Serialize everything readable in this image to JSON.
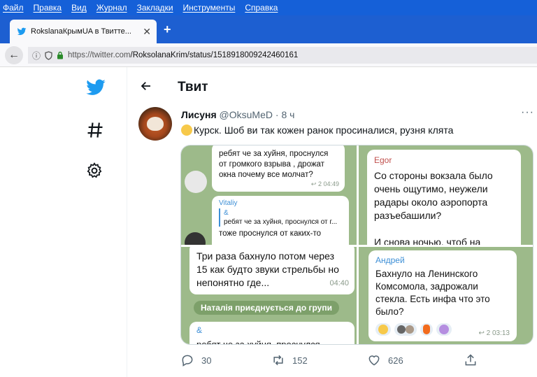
{
  "browser": {
    "menu": [
      "Файл",
      "Правка",
      "Вид",
      "Журнал",
      "Закладки",
      "Инструменты",
      "Справка"
    ],
    "tab_title": "RokslanaКрымUA в Твитте...",
    "url_prefix": "https://twitter.com",
    "url_path": "/RoksolanaKrim/status/1518918009242460161"
  },
  "page": {
    "title": "Твит"
  },
  "tweet": {
    "author_name": "Лисуня",
    "author_handle": "@OksuMeD",
    "separator": "·",
    "time": "8 ч",
    "text": "Курск. Шоб ви так кожен ранок просиналися, рузня клята",
    "replies": "30",
    "retweets": "152",
    "likes": "626"
  },
  "media": {
    "cell1": {
      "msg1": "ребят че за хуйня, проснулся от громкого взрыва , дрожат окна почему все молчат?",
      "msg1_reply": "2",
      "msg1_time": "04:49",
      "reply_author": "Vitaliy",
      "reply_quote_sym": "&",
      "reply_quote": "ребят че за хуйня, проснулся от г...",
      "reply_text": "тоже проснулся от каких-то"
    },
    "cell2": {
      "author": "Egor",
      "text": "Со стороны вокзала было очень ощутимо, неужели радары около аэропорта разъебашили?",
      "text2": "И снова ночью, чтоб на"
    },
    "cell3": {
      "text": "Три раза бахнуло потом через 15 как будто звуки стрельбы но непонятно где...",
      "time": "04:40",
      "system": "Наталія приєднується до групи",
      "next_sym": "&",
      "next_text": "ребят че за хуйня, проснулся"
    },
    "cell4": {
      "author": "Андрей",
      "text": "Бахнуло на Ленинского Комсомола, задрожали стекла. Есть инфа что это было?",
      "reply_count": "2",
      "time": "03:13"
    }
  },
  "colors": {
    "menubar": "#1560d8",
    "twitter_blue": "#1d9bf0",
    "chat_bg": "#9dba8a"
  }
}
